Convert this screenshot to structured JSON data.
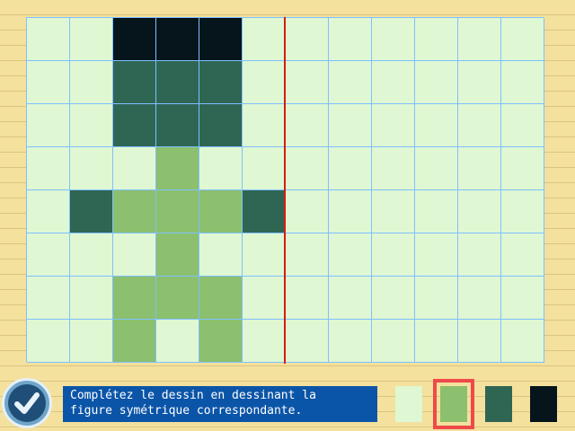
{
  "instruction": {
    "text": "Complétez le dessin en dessinant la\nfigure symétrique correspondante."
  },
  "colors": {
    "empty": "#dff7d2",
    "light_green": "#8cbf6e",
    "dark_green": "#2f6553",
    "black": "#06141c",
    "grid_line": "#7ec0ff",
    "axis": "#d51d12",
    "selection": "#ee4a4a"
  },
  "palette": {
    "items": [
      {
        "name": "light-cream-swatch",
        "color": "#dff7d2"
      },
      {
        "name": "light-green-swatch",
        "color": "#8cbf6e"
      },
      {
        "name": "dark-green-swatch",
        "color": "#2f6553"
      },
      {
        "name": "black-swatch",
        "color": "#06141c"
      }
    ],
    "selected_index": 1
  },
  "grid": {
    "columns": 12,
    "rows": 8,
    "mirror_after_column": 6,
    "cells": [
      [
        0,
        0,
        3,
        3,
        3,
        0,
        0,
        0,
        0,
        0,
        0,
        0
      ],
      [
        0,
        0,
        2,
        2,
        2,
        0,
        0,
        0,
        0,
        0,
        0,
        0
      ],
      [
        0,
        0,
        2,
        2,
        2,
        0,
        0,
        0,
        0,
        0,
        0,
        0
      ],
      [
        0,
        0,
        0,
        1,
        0,
        0,
        0,
        0,
        0,
        0,
        0,
        0
      ],
      [
        0,
        2,
        1,
        1,
        1,
        2,
        0,
        0,
        0,
        0,
        0,
        0
      ],
      [
        0,
        0,
        0,
        1,
        0,
        0,
        0,
        0,
        0,
        0,
        0,
        0
      ],
      [
        0,
        0,
        1,
        1,
        1,
        0,
        0,
        0,
        0,
        0,
        0,
        0
      ],
      [
        0,
        0,
        1,
        0,
        1,
        0,
        0,
        0,
        0,
        0,
        0,
        0
      ]
    ]
  },
  "icons": {
    "ok": "checkmark-icon"
  }
}
